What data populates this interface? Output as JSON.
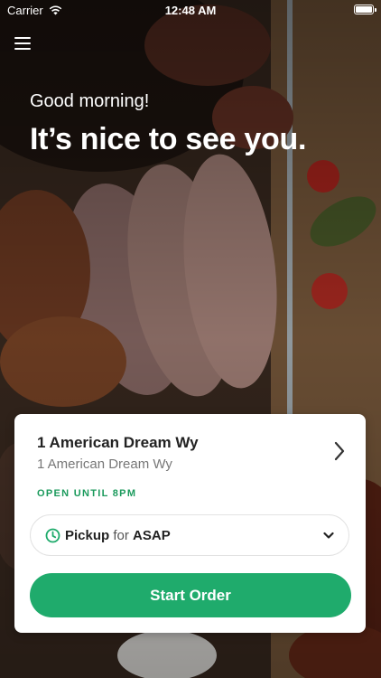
{
  "status_bar": {
    "carrier": "Carrier",
    "time": "12:48 AM"
  },
  "header": {
    "greeting": "Good morning!",
    "headline": "It’s nice to see you."
  },
  "location_card": {
    "title": "1 American Dream Wy",
    "subtitle": "1 American Dream Wy",
    "open_status": "OPEN UNTIL 8PM",
    "mode": "Pickup",
    "connector": "for",
    "time": "ASAP",
    "button_label": "Start Order"
  },
  "colors": {
    "accent": "#1fab6c",
    "status_green": "#1b9a5c"
  },
  "icons": {
    "menu": "hamburger-menu-icon",
    "wifi": "wifi-icon",
    "battery": "battery-icon",
    "chevron_right": "chevron-right-icon",
    "clock": "clock-icon",
    "chevron_down": "chevron-down-icon"
  }
}
